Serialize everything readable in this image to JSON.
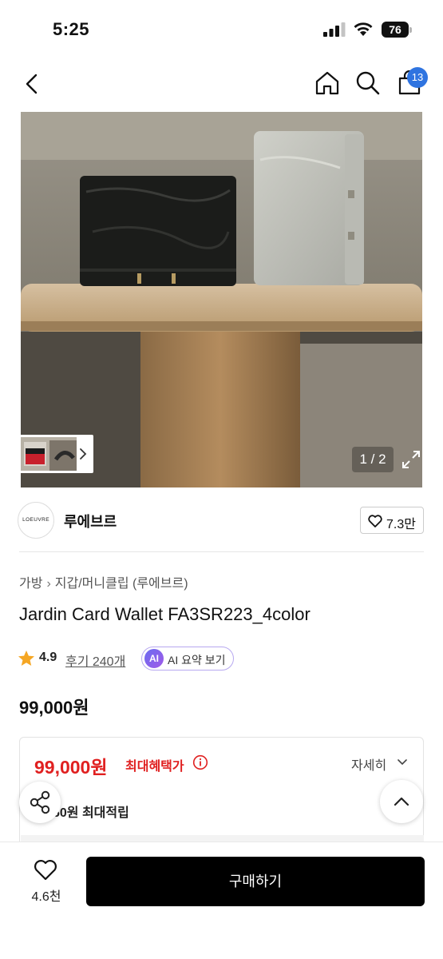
{
  "status_bar": {
    "time": "5:25",
    "battery": "76"
  },
  "nav": {
    "cart_count": "13"
  },
  "product_image": {
    "page_indicator": "1 / 2"
  },
  "brand": {
    "logo_text": "LOEUVRE",
    "name": "루에브르",
    "like_count": "7.3만"
  },
  "breadcrumb": [
    "가방",
    "지갑/머니클립 (루에브르)"
  ],
  "product": {
    "title": "Jardin Card Wallet FA3SR223_4color",
    "rating": "4.9",
    "review_link": "후기 240개",
    "ai_badge": "AI",
    "ai_summary": "AI 요약 보기",
    "price": "99,000원"
  },
  "benefit": {
    "price": "99,000원",
    "label": "최대혜택가",
    "detail_label": "자세히",
    "points": "60원 최대적립"
  },
  "bottom_bar": {
    "wish_count": "4.6천",
    "buy_label": "구매하기"
  },
  "colors": {
    "accent_red": "#e02020",
    "badge_blue": "#2f74e0",
    "buy_black": "#000000"
  }
}
